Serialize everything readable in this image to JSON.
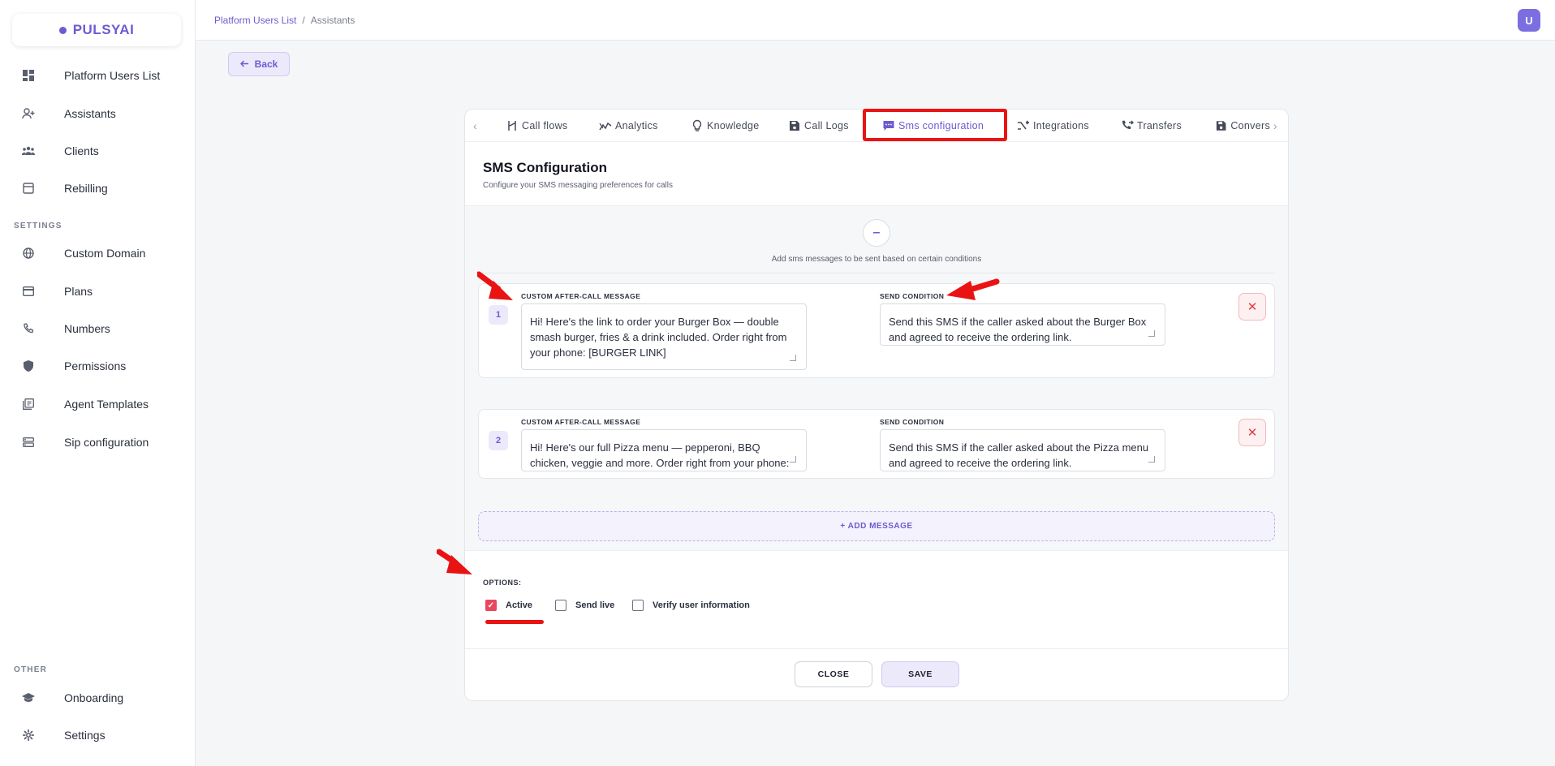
{
  "sidebar": {
    "logo": "PULSYAI",
    "items": [
      {
        "label": "Platform Users List",
        "icon": "dashboard-icon"
      },
      {
        "label": "Assistants",
        "icon": "user-plus-icon"
      },
      {
        "label": "Clients",
        "icon": "users-icon"
      },
      {
        "label": "Rebilling",
        "icon": "store-icon"
      }
    ],
    "settings_heading": "SETTINGS",
    "settings_items": [
      {
        "label": "Custom Domain",
        "icon": "globe-icon"
      },
      {
        "label": "Plans",
        "icon": "credit-card-icon"
      },
      {
        "label": "Numbers",
        "icon": "phone-icon"
      },
      {
        "label": "Permissions",
        "icon": "shield-icon"
      },
      {
        "label": "Agent Templates",
        "icon": "library-icon"
      },
      {
        "label": "Sip configuration",
        "icon": "server-icon"
      }
    ],
    "other_heading": "OTHER",
    "other_items": [
      {
        "label": "Onboarding",
        "icon": "graduation-cap-icon"
      },
      {
        "label": "Settings",
        "icon": "gear-icon"
      }
    ]
  },
  "header": {
    "breadcrumb_link": "Platform Users List",
    "breadcrumb_sep": "/",
    "breadcrumb_current": "Assistants",
    "avatar_initial": "U"
  },
  "back_label": "Back",
  "tabs": [
    {
      "label": "Call flows",
      "icon": "flow-icon"
    },
    {
      "label": "Analytics",
      "icon": "analytics-icon"
    },
    {
      "label": "Knowledge",
      "icon": "lightbulb-icon"
    },
    {
      "label": "Call Logs",
      "icon": "save-icon"
    },
    {
      "label": "Sms configuration",
      "icon": "sms-icon",
      "active": true
    },
    {
      "label": "Integrations",
      "icon": "merge-icon"
    },
    {
      "label": "Transfers",
      "icon": "phone-forward-icon"
    },
    {
      "label": "Convers",
      "icon": "save-icon"
    }
  ],
  "sms": {
    "title": "SMS Configuration",
    "subtitle": "Configure your SMS messaging preferences for calls",
    "hint": "Add sms messages to be sent based on certain conditions",
    "message_label": "CUSTOM AFTER-CALL MESSAGE",
    "condition_label": "SEND CONDITION",
    "rules": [
      {
        "number": "1",
        "message": "Hi! Here's the link to order your Burger Box — double smash burger, fries & a drink included. Order right from your phone: [BURGER LINK]",
        "condition": "Send this SMS if the caller asked about the Burger Box and agreed to receive the ordering link."
      },
      {
        "number": "2",
        "message": "Hi! Here's our full Pizza menu — pepperoni, BBQ chicken, veggie and more. Order right from your phone: [PIZZA LINK]",
        "condition": "Send this SMS if the caller asked about the Pizza menu and agreed to receive the ordering link."
      }
    ],
    "add_message": "+ ADD MESSAGE"
  },
  "options": {
    "heading": "OPTIONS:",
    "items": [
      {
        "label": "Active",
        "checked": true
      },
      {
        "label": "Send live",
        "checked": false
      },
      {
        "label": "Verify user information",
        "checked": false
      }
    ]
  },
  "footer": {
    "close": "CLOSE",
    "save": "SAVE"
  },
  "colors": {
    "accent": "#6d5bd0",
    "annotation_red": "#ea1313",
    "checkbox_active": "#e9475e"
  }
}
